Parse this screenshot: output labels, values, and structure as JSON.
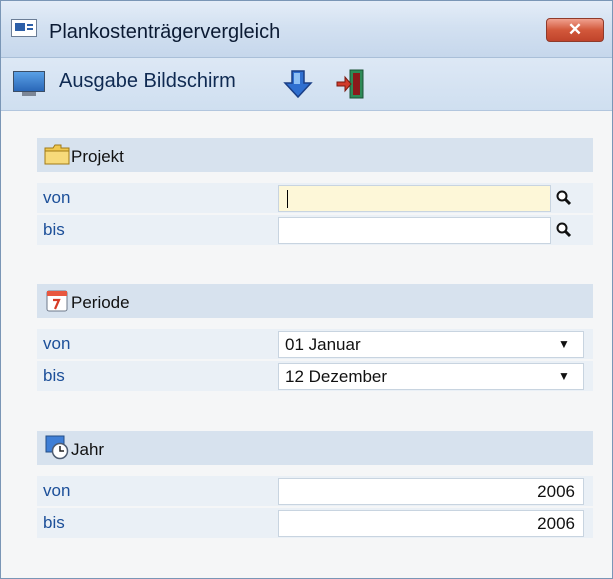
{
  "window": {
    "title": "Plankostenträgervergleich",
    "close_label": "✕"
  },
  "toolbar": {
    "output_label": "Ausgabe Bildschirm",
    "icons": [
      "monitor-icon",
      "arrow-down-icon",
      "exit-door-icon"
    ]
  },
  "sections": {
    "projekt": {
      "title": "Projekt",
      "icon": "folder-icon",
      "von_label": "von",
      "bis_label": "bis",
      "von_value": "",
      "bis_value": ""
    },
    "periode": {
      "title": "Periode",
      "icon": "calendar-icon",
      "von_label": "von",
      "bis_label": "bis",
      "von_value": "01 Januar",
      "bis_value": "12 Dezember"
    },
    "jahr": {
      "title": "Jahr",
      "icon": "calendar-clock-icon",
      "von_label": "von",
      "bis_label": "bis",
      "von_value": "2006",
      "bis_value": "2006"
    }
  },
  "colors": {
    "label_blue": "#1c4f99",
    "section_bg": "#d7e2ee",
    "row_bg": "#eaf0f6",
    "active_field": "#fdf7d8",
    "close_red": "#c0432b"
  }
}
